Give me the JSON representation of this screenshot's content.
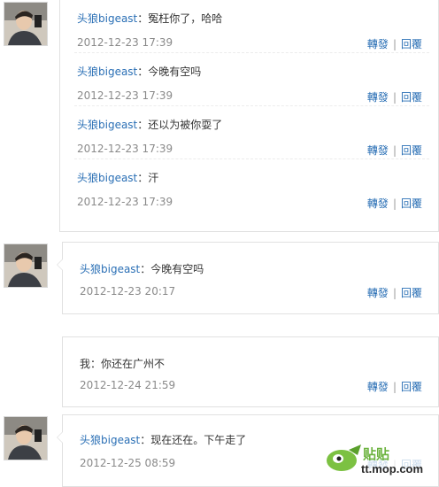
{
  "actions": {
    "forward": "轉發",
    "reply": "回覆",
    "sep": "|"
  },
  "thread1": {
    "entries": [
      {
        "user": "头狼bigeast",
        "colon": "：",
        "text": "冤枉你了，哈哈",
        "time": "2012-12-23 17:39"
      },
      {
        "user": "头狼bigeast",
        "colon": "：",
        "text": "今晚有空吗",
        "time": "2012-12-23 17:39"
      },
      {
        "user": "头狼bigeast",
        "colon": "：",
        "text": "还以为被你耍了",
        "time": "2012-12-23 17:39"
      },
      {
        "user": "头狼bigeast",
        "colon": "：",
        "text": "汗",
        "time": "2012-12-23 17:39"
      }
    ]
  },
  "thread2": {
    "user": "头狼bigeast",
    "colon": "：",
    "text": "今晚有空吗",
    "time": "2012-12-23 20:17"
  },
  "thread3": {
    "user": "我",
    "colon": "：",
    "text": "你还在广州不",
    "time": "2012-12-24 21:59"
  },
  "thread4": {
    "user": "头狼bigeast",
    "colon": "：",
    "text": "现在还在。下午走了",
    "time": "2012-12-25 08:59"
  },
  "watermark": {
    "brand": "贴贴",
    "domain": "tt.mop.com"
  }
}
